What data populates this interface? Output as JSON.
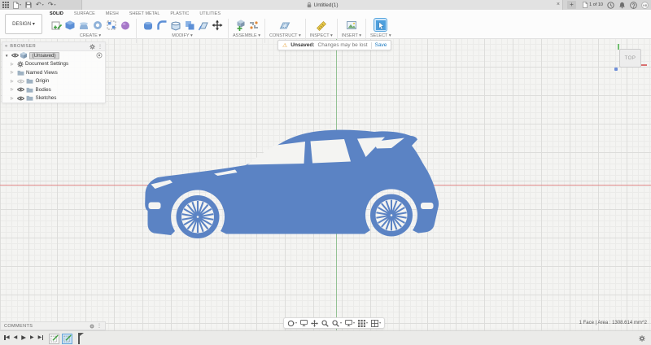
{
  "titlebar": {
    "document_title": "Untitled(1)",
    "quota": "1 of 10",
    "avatar_initials": "HB"
  },
  "toolbar": {
    "design_button": "DESIGN ▾",
    "tabs": [
      "SOLID",
      "SURFACE",
      "MESH",
      "SHEET METAL",
      "PLASTIC",
      "UTILITIES"
    ],
    "active_tab": "SOLID",
    "groups": [
      "CREATE ▾",
      "MODIFY ▾",
      "ASSEMBLE ▾",
      "CONSTRUCT ▾",
      "INSPECT ▾",
      "INSERT ▾",
      "SELECT ▾"
    ]
  },
  "warning_bar": {
    "icon": "⚠",
    "label": "Unsaved:",
    "message": "Changes may be lost",
    "action": "Save"
  },
  "browser": {
    "collapse": "«",
    "title": "BROWSER",
    "root_label": "(Unsaved)",
    "items": [
      {
        "label": "Document Settings"
      },
      {
        "label": "Named Views"
      },
      {
        "label": "Origin"
      },
      {
        "label": "Bodies"
      },
      {
        "label": "Sketches"
      }
    ]
  },
  "viewcube": {
    "face": "TOP"
  },
  "comments": {
    "title": "COMMENTS"
  },
  "status_bar": {
    "selection_info": "1 Face | Area : 1308.614 mm^2"
  },
  "icons": {
    "close": "×",
    "new_tab": "+",
    "caret": "▾",
    "undo": "↶",
    "redo": "↷",
    "overflow": "⋮",
    "tri_collapsed": "▷",
    "tri_expanded": "▼",
    "prev": "◀",
    "play": "▶",
    "next": "▶"
  },
  "colors": {
    "selected_face_blue": "#5b83c4",
    "axis_x_red": "#e08a8a",
    "axis_y_green": "#94c294",
    "active_tool_highlight": "#cfe7fa",
    "save_link_blue": "#1b79c0"
  }
}
